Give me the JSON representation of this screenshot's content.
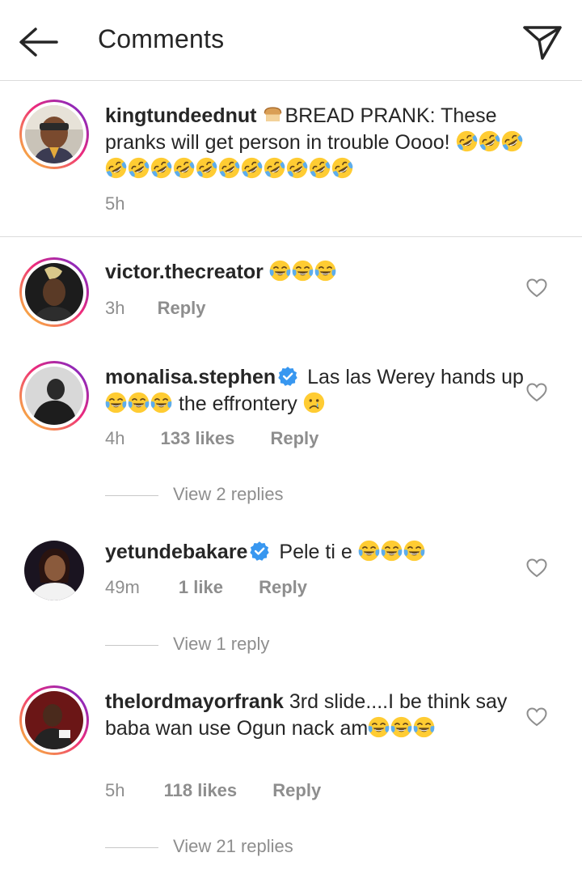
{
  "header": {
    "title": "Comments",
    "back_icon": "arrow-left-icon",
    "send_icon": "paper-plane-icon"
  },
  "caption": {
    "username": "kingtundeednut",
    "text_before_emoji": "BREAD PRANK: These pranks will get person in trouble Oooo!",
    "bread_emoji": "🍞",
    "rofl_emoji_count": 14,
    "time": "5h"
  },
  "comments": [
    {
      "username": "victor.thecreator",
      "text": "",
      "emoji": "😂",
      "emoji_count": 3,
      "time": "3h",
      "reply_label": "Reply"
    },
    {
      "username": "monalisa.stephen",
      "verified": true,
      "text_a": "Las las Werey hands up",
      "laugh_count": 3,
      "text_b": "the effrontery",
      "crying_emoji": "😢",
      "time": "4h",
      "likes": "133 likes",
      "reply_label": "Reply",
      "view_replies": "View 2 replies"
    },
    {
      "username": "yetundebakare",
      "verified": true,
      "text": "Pele ti e",
      "emoji_count": 3,
      "time": "49m",
      "likes": "1 like",
      "reply_label": "Reply",
      "view_replies": "View 1 reply"
    },
    {
      "username": "thelordmayorfrank",
      "text": "3rd slide....I be think say baba wan use Ogun nack am",
      "emoji_count": 3,
      "time": "5h",
      "likes": "118 likes",
      "reply_label": "Reply",
      "view_replies": "View 21 replies"
    }
  ],
  "colors": {
    "text": "#262626",
    "secondary": "#8e8e8e",
    "divider": "#dbdbdb",
    "verified": "#3897f0",
    "story_ring_start": "#f9ce34",
    "story_ring_end": "#6228d7"
  }
}
